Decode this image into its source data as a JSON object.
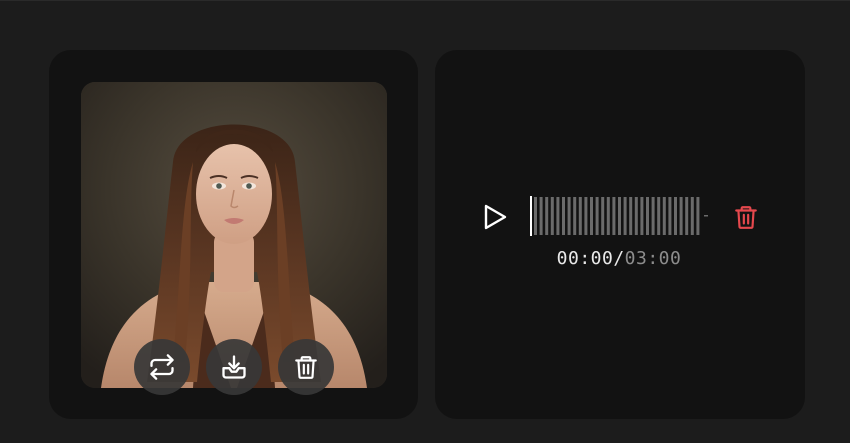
{
  "image_panel": {
    "actions": [
      {
        "icon": "swap-icon",
        "name": "replace"
      },
      {
        "icon": "download-icon",
        "name": "download"
      },
      {
        "icon": "trash-icon",
        "name": "delete"
      }
    ]
  },
  "audio_panel": {
    "current_time": "00:00",
    "separator": "/",
    "total_time": "03:00",
    "progress": 0,
    "play_icon": "play-icon",
    "delete_icon": "trash-icon",
    "delete_color": "#e5484d"
  },
  "colors": {
    "background": "#1c1c1c",
    "card": "#121212",
    "wave_bar": "#6b6b6b",
    "accent_delete": "#e5484d"
  }
}
